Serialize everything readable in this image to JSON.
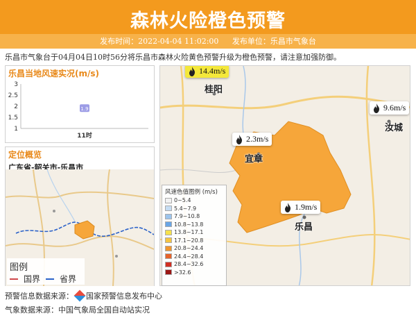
{
  "header": {
    "title": "森林火险橙色预警",
    "publish_time": "发布时间：2022-04-04 11:02:00",
    "publisher": "发布单位：乐昌市气象台"
  },
  "intro": "乐昌市气象台于04月04日10时56分将乐昌市森林火险黄色预警升级为橙色预警，请注意加强防御。",
  "wind_panel": {
    "title": "乐昌当地风速实况(m/s)",
    "chart_data": {
      "type": "scatter",
      "x": [
        "11时"
      ],
      "values": [
        1.9
      ],
      "ylim": [
        1,
        3
      ],
      "yticks": [
        1,
        1.5,
        2,
        2.5,
        3
      ]
    }
  },
  "location_panel": {
    "title": "定位概览",
    "region": "广东省-韶关市-乐昌市",
    "legend_title": "图例",
    "legend_items": [
      "国界",
      "省界"
    ]
  },
  "map": {
    "badges": [
      {
        "value": "14.4m/s",
        "city": "桂阳",
        "highlight": true
      },
      {
        "value": "9.6m/s",
        "city": "汝城",
        "highlight": false
      },
      {
        "value": "2.3m/s",
        "city": "宜章",
        "highlight": false
      },
      {
        "value": "1.9m/s",
        "city": "乐昌",
        "highlight": false
      }
    ],
    "legend_title": "风速色值图例 (m/s)",
    "legend": [
      {
        "label": "0~5.4",
        "color": "#f2f2f2"
      },
      {
        "label": "5.4~7.9",
        "color": "#c6ddf3"
      },
      {
        "label": "7.9~10.8",
        "color": "#9cc4ec"
      },
      {
        "label": "10.8~13.8",
        "color": "#6aa6e6"
      },
      {
        "label": "13.8~17.1",
        "color": "#f6e14b"
      },
      {
        "label": "17.1~20.8",
        "color": "#f5c542"
      },
      {
        "label": "20.8~24.4",
        "color": "#f0962f"
      },
      {
        "label": "24.4~28.4",
        "color": "#e6632a"
      },
      {
        "label": "28.4~32.6",
        "color": "#d12f22"
      },
      {
        "label": ">32.6",
        "color": "#9c1714"
      }
    ]
  },
  "footer": {
    "warning_source": "预警信息数据来源：",
    "warning_source_name": "国家预警信息发布中心",
    "weather_source": "气象数据来源：中国气象局全国自动站实况"
  },
  "colors": {
    "accent": "#f39a1e",
    "region_fill": "#f6a63a"
  }
}
